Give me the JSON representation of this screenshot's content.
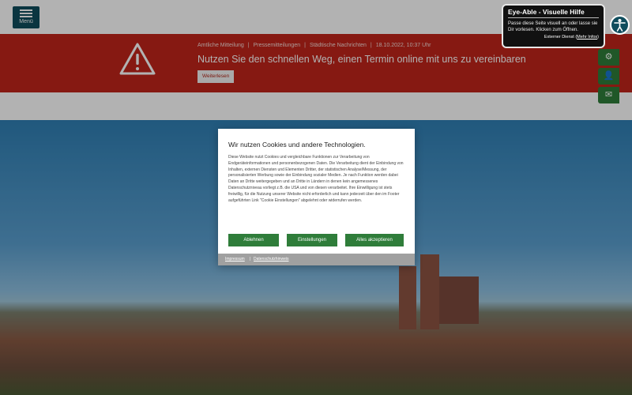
{
  "header": {
    "menu_label": "Menü"
  },
  "alert": {
    "meta": [
      "Amtliche Mitteilung",
      "Pressemitteilungen",
      "Städtische Nachrichten",
      "18.10.2022, 10:37 Uhr"
    ],
    "title": "Nutzen Sie den schnellen Weg, einen Termin online mit uns zu vereinbaren",
    "button": "Weiterlesen",
    "icon": "warning-icon"
  },
  "side_tabs": [
    {
      "icon": "gear-icon",
      "glyph": "⚙"
    },
    {
      "icon": "person-icon",
      "glyph": "👤"
    },
    {
      "icon": "mail-icon",
      "glyph": "✉"
    }
  ],
  "eye_able": {
    "title": "Eye-Able - Visuelle Hilfe",
    "description": "Passe diese Seite visuell an oder lasse sie Dir vorlesen. Klicken zum Öffnen.",
    "external": "Externer Dienst",
    "info_link": "Mehr Infos"
  },
  "cookie": {
    "title": "Wir nutzen Cookies und andere Technologien.",
    "text": "Diese Website nutzt Cookies und vergleichbare Funktionen zur Verarbeitung von Endgeräteinformationen und personenbezogenen Daten. Die Verarbeitung dient der Einbindung von Inhalten, externen Diensten und Elementen Dritter, der statistischen Analyse/Messung, der personalisierten Werbung sowie der Einbindung sozialer Medien. Je nach Funktion werden dabei Daten an Dritte weitergegeben und an Dritte in Ländern in denen kein angemessenes Datenschutzniveau vorliegt z.B. die USA und von diesen verarbeitet. Ihre Einwilligung ist stets freiwillig, für die Nutzung unserer Website nicht erforderlich und kann jederzeit über den im Footer aufgeführten Link \"Cookie Einstellungen\" abgelehnt oder widerrufen werden.",
    "buttons": {
      "reject": "Ablehnen",
      "settings": "Einstellungen",
      "accept": "Alles akzeptieren"
    },
    "footer": {
      "imprint": "Impressum",
      "privacy": "Datenschutzhinweis",
      "separator": "|"
    }
  }
}
